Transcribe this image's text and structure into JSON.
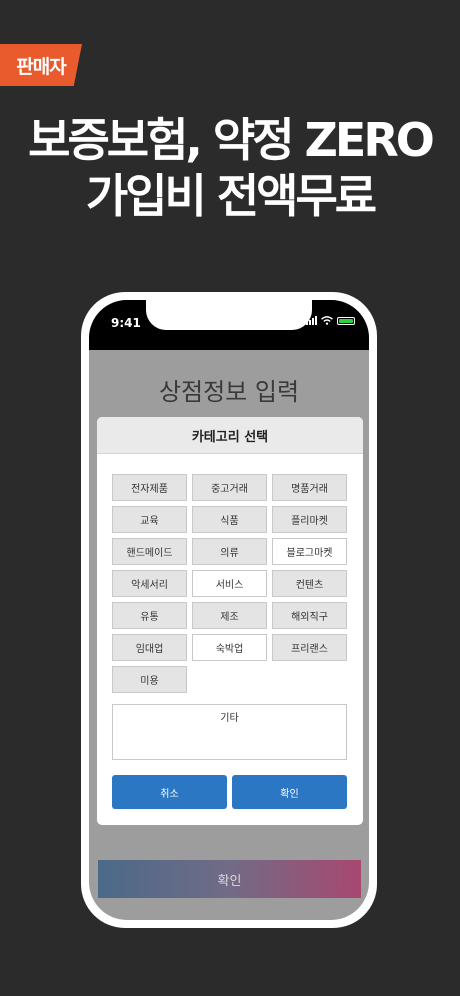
{
  "badge": "판매자",
  "headline": {
    "line1": "보증보험, 약정 ZERO",
    "line2": "가입비 전액무료"
  },
  "status_bar": {
    "time": "9:41"
  },
  "page_title": "상점정보 입력",
  "modal": {
    "title": "카테고리 선택",
    "categories": [
      "전자제품",
      "중고거래",
      "명품거래",
      "교육",
      "식품",
      "플리마켓",
      "핸드메이드",
      "의류",
      "블로그마켓",
      "악세서리",
      "서비스",
      "컨텐츠",
      "유통",
      "제조",
      "해외직구",
      "임대업",
      "숙박업",
      "프리랜스",
      "미용"
    ],
    "etc_label": "기타",
    "cancel_label": "취소",
    "confirm_label": "확인"
  },
  "bottom_button": "확인",
  "colors": {
    "badge": "#e95a2c",
    "button": "#2b77c4",
    "background": "#2b2b2b"
  }
}
